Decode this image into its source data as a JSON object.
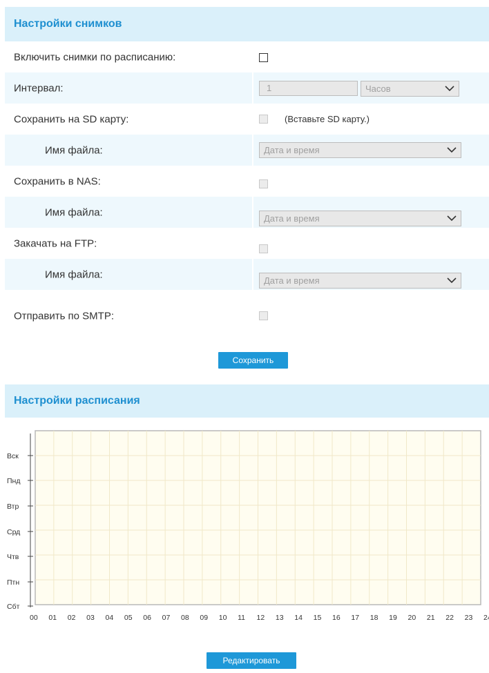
{
  "snapshot": {
    "title": "Настройки снимков",
    "rows": [
      {
        "label": "Включить снимки по расписанию:"
      },
      {
        "label": "Интервал:",
        "interval_value": "1",
        "unit": "Часов"
      },
      {
        "label": "Сохранить на SD карту:",
        "hint": "(Вставьте SD карту.)"
      },
      {
        "label": "Имя файла:",
        "value": "Дата и время"
      },
      {
        "label": "Сохранить в NAS:"
      },
      {
        "label": "Имя файла:",
        "value": "Дата и время"
      },
      {
        "label": "Закачать на FTP:"
      },
      {
        "label": "Имя файла:",
        "value": "Дата и время"
      },
      {
        "label": "Отправить по SMTP:"
      }
    ],
    "save_label": "Сохранить"
  },
  "schedule": {
    "title": "Настройки расписания",
    "days": [
      "Вск",
      "Пнд",
      "Втр",
      "Срд",
      "Чтв",
      "Птн",
      "Сбт"
    ],
    "hours": [
      "00",
      "01",
      "02",
      "03",
      "04",
      "05",
      "06",
      "07",
      "08",
      "09",
      "10",
      "11",
      "12",
      "13",
      "14",
      "15",
      "16",
      "17",
      "18",
      "19",
      "20",
      "21",
      "22",
      "23",
      "24"
    ],
    "edit_label": "Редактировать"
  },
  "colors": {
    "accent": "#1e98d8",
    "header_bg": "#daf0fa",
    "header_text": "#1e8fd0",
    "alt_row_bg": "#eef8fd",
    "grid_bg": "#fffdf0"
  }
}
